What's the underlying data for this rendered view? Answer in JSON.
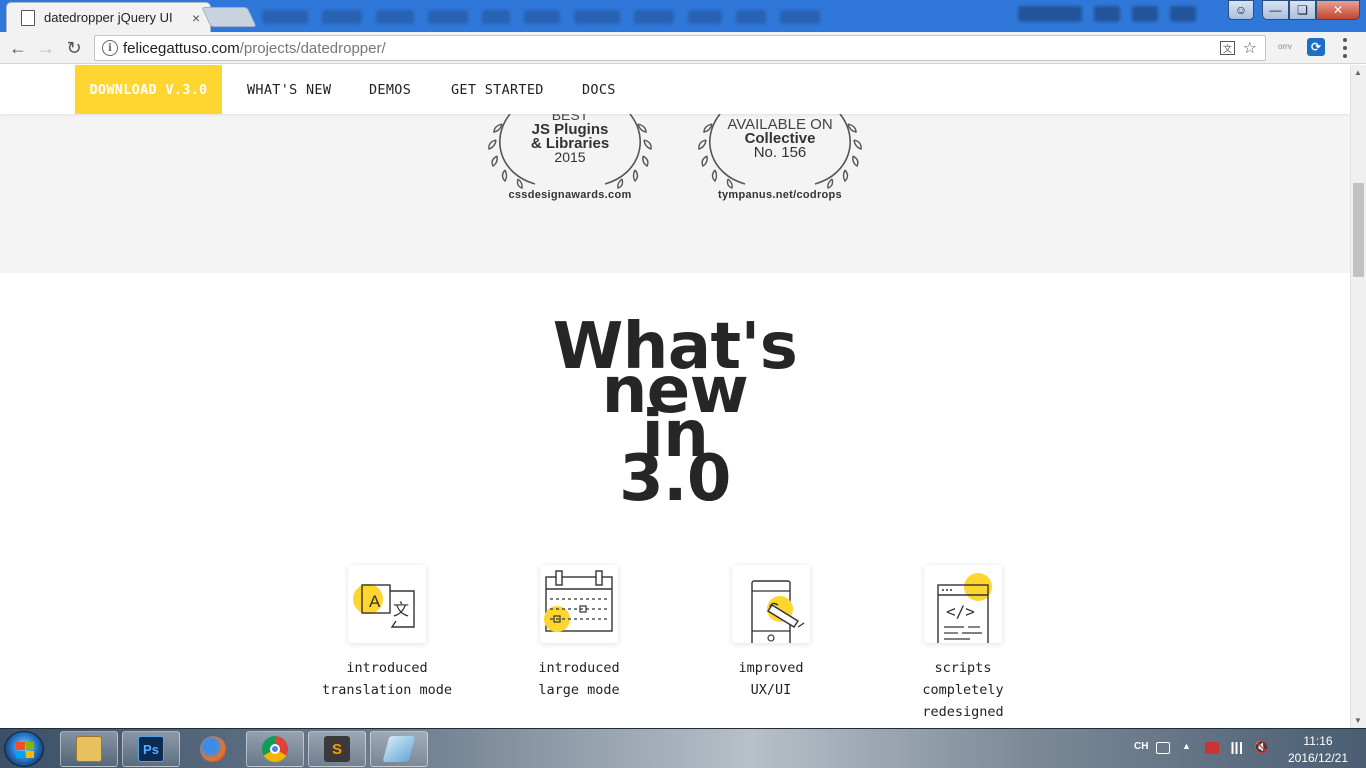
{
  "browser": {
    "tab_title": "datedropper jQuery UI",
    "tab_close": "×",
    "url_domain": "felicegattuso.com",
    "url_path": "/projects/datedropper/",
    "extension_label": "orrv"
  },
  "site_nav": {
    "download": "DOWNLOAD V.3.0",
    "links": [
      "WHAT'S NEW",
      "DEMOS",
      "GET STARTED",
      "DOCS"
    ]
  },
  "awards": [
    {
      "line1": "BEST",
      "line2a": "JS Plugins",
      "line2b": "& Libraries",
      "line3": "2015",
      "source": "cssdesignawards.com"
    },
    {
      "line1": "AVAILABLE ON",
      "line2a": "Collective",
      "line2b": "No. 156",
      "line3": "",
      "source": "tympanus.net/codrops"
    }
  ],
  "headline": [
    "What's",
    "new",
    "in",
    "3.0"
  ],
  "features": [
    {
      "line1": "introduced",
      "line2": "translation mode",
      "line3": "",
      "icon": "translation-icon"
    },
    {
      "line1": "introduced",
      "line2": "large mode",
      "line3": "",
      "icon": "calendar-large-icon"
    },
    {
      "line1": "improved",
      "line2": "UX/UI",
      "line3": "",
      "icon": "touch-phone-icon"
    },
    {
      "line1": "scripts",
      "line2": "completely",
      "line3": "redesigned",
      "icon": "code-window-icon"
    }
  ],
  "taskbar": {
    "lang": "CH",
    "time": "11:16",
    "date": "2016/12/21"
  },
  "colors": {
    "accent": "#ffd630",
    "awards_bg": "#f4f4f4",
    "text": "#262626"
  }
}
